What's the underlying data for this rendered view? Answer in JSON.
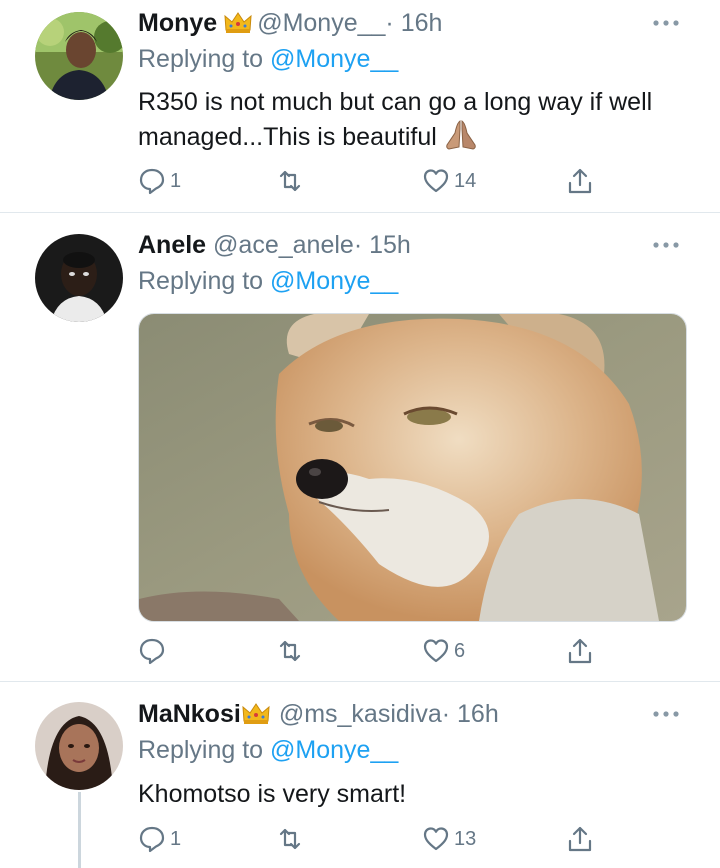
{
  "tweets": [
    {
      "name": "Monye",
      "handle": "@Monye__",
      "time": "· 16h",
      "replying_label": "Replying to",
      "replying_to": "@Monye__",
      "text": "R350 is not much but can go a long way if well managed...This is beautiful",
      "emoji": "folded-hands",
      "has_crown": true,
      "replies": "1",
      "retweets": "",
      "likes": "14"
    },
    {
      "name": "Anele",
      "handle": "@ace_anele",
      "time": "· 15h",
      "replying_label": "Replying to",
      "replying_to": "@Monye__",
      "text": "",
      "media": "fox-photo",
      "has_crown": false,
      "replies": "",
      "retweets": "",
      "likes": "6"
    },
    {
      "name": "MaNkosi",
      "handle": "@ms_kasidiva",
      "time": "· 16h",
      "replying_label": "Replying to",
      "replying_to": "@Monye__",
      "text": "Khomotso is very smart!",
      "has_crown": true,
      "replies": "1",
      "retweets": "",
      "likes": "13"
    }
  ],
  "icons": {
    "reply": "reply-icon",
    "retweet": "retweet-icon",
    "like": "heart-icon",
    "share": "share-icon",
    "more": "more-icon",
    "crown": "crown-emoji"
  },
  "colors": {
    "text": "#14171a",
    "secondary": "#657786",
    "link": "#1da1f2",
    "divider": "#e1e8ed"
  }
}
